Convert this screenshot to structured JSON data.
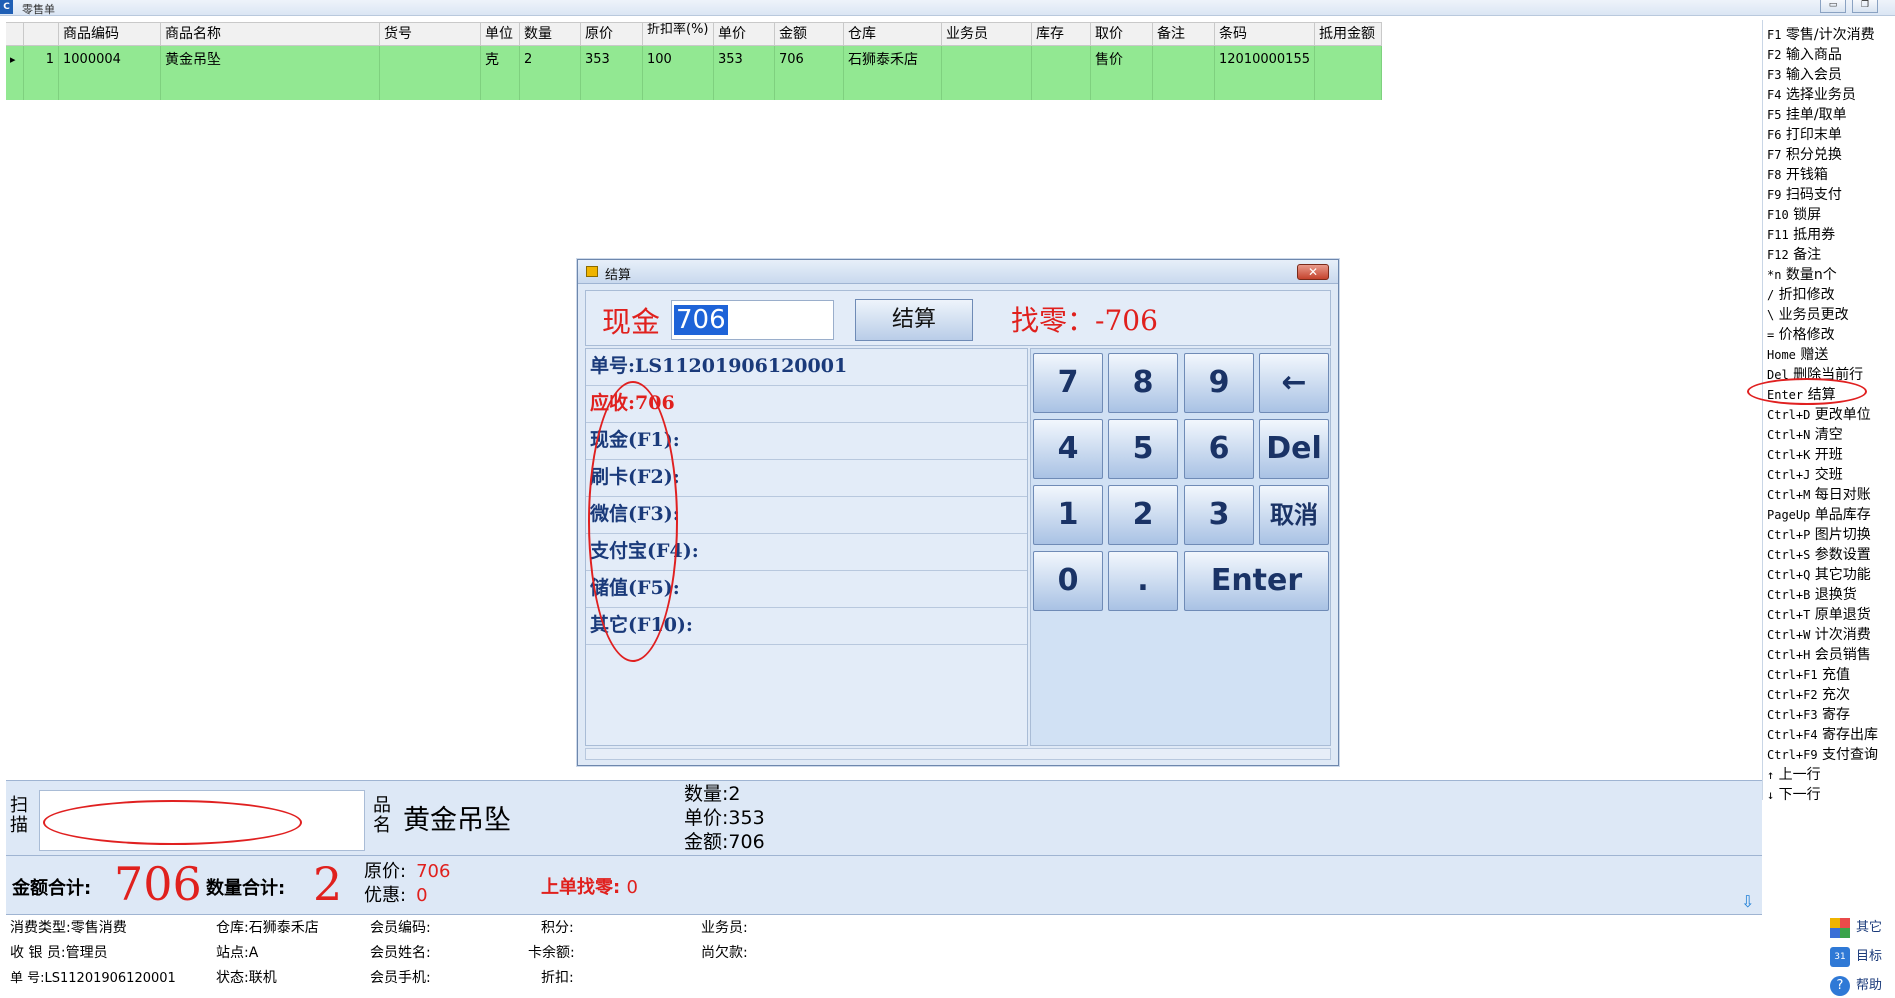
{
  "window": {
    "title": "零售单",
    "app_icon": "C",
    "min_label": "▭",
    "restore_label": "❐"
  },
  "grid": {
    "headers": [
      "",
      "",
      "商品编码",
      "商品名称",
      "货号",
      "单位",
      "数量",
      "原价",
      "折扣率(%)",
      "单价",
      "金额",
      "仓库",
      "业务员",
      "库存",
      "取价",
      "备注",
      "条码",
      "抵用金额"
    ],
    "row": {
      "indicator": "▸",
      "index": "1",
      "code": "1000004",
      "name": "黄金吊坠",
      "item_no": "",
      "unit": "克",
      "qty": "2",
      "orig_price": "353",
      "discount": "100",
      "price": "353",
      "amount": "706",
      "warehouse": "石狮泰禾店",
      "salesman": "",
      "stock": "",
      "price_type": "售价",
      "remark": "",
      "barcode": "12010000155",
      "offset": ""
    }
  },
  "shortcuts": [
    {
      "k": "F1",
      "t": " 零售/计次消费"
    },
    {
      "k": "F2",
      "t": " 输入商品"
    },
    {
      "k": "F3",
      "t": " 输入会员"
    },
    {
      "k": "F4",
      "t": " 选择业务员"
    },
    {
      "k": "F5",
      "t": " 挂单/取单"
    },
    {
      "k": "F6",
      "t": " 打印末单"
    },
    {
      "k": "F7",
      "t": " 积分兑换"
    },
    {
      "k": "F8",
      "t": " 开钱箱"
    },
    {
      "k": "F9",
      "t": " 扫码支付"
    },
    {
      "k": "F10",
      "t": " 锁屏"
    },
    {
      "k": "F11",
      "t": " 抵用券"
    },
    {
      "k": "F12",
      "t": " 备注"
    },
    {
      "k": "*n",
      "t": "  数量n个"
    },
    {
      "k": "/",
      "t": " 折扣修改"
    },
    {
      "k": "\\",
      "t": " 业务员更改"
    },
    {
      "k": "=",
      "t": " 价格修改"
    },
    {
      "k": "Home",
      "t": " 赠送"
    },
    {
      "k": "Del",
      "t": " 删除当前行"
    },
    {
      "k": "Enter",
      "t": " 结算"
    },
    {
      "k": "Ctrl+D",
      "t": " 更改单位"
    },
    {
      "k": "Ctrl+N",
      "t": " 清空"
    },
    {
      "k": "Ctrl+K",
      "t": " 开班"
    },
    {
      "k": "Ctrl+J",
      "t": " 交班"
    },
    {
      "k": "Ctrl+M",
      "t": " 每日对账"
    },
    {
      "k": "PageUp",
      "t": " 单品库存"
    },
    {
      "k": "Ctrl+P",
      "t": " 图片切换"
    },
    {
      "k": "Ctrl+S",
      "t": " 参数设置"
    },
    {
      "k": "Ctrl+Q",
      "t": " 其它功能"
    },
    {
      "k": "Ctrl+B",
      "t": " 退换货"
    },
    {
      "k": "Ctrl+T",
      "t": " 原单退货"
    },
    {
      "k": "Ctrl+W",
      "t": " 计次消费"
    },
    {
      "k": "Ctrl+H",
      "t": " 会员销售"
    },
    {
      "k": "Ctrl+F1",
      "t": " 充值"
    },
    {
      "k": "Ctrl+F2",
      "t": " 充次"
    },
    {
      "k": "Ctrl+F3",
      "t": " 寄存"
    },
    {
      "k": "Ctrl+F4",
      "t": " 寄存出库"
    },
    {
      "k": "Ctrl+F9",
      "t": " 支付查询"
    },
    {
      "k": "↑",
      "t": "  上一行"
    },
    {
      "k": "↓",
      "t": "  下一行"
    }
  ],
  "dialog": {
    "title": "结算",
    "close_label": "✕",
    "cash_label": "现金",
    "cash_value": "706",
    "settle_label": "结算",
    "change_text": "找零：-706",
    "rows": [
      "单号:LS11201906120001",
      "应收:706",
      "现金(F1):",
      "刷卡(F2):",
      "微信(F3):",
      "支付宝(F4):",
      "储值(F5):",
      "其它(F10):"
    ],
    "keys": [
      "7",
      "8",
      "9",
      "←",
      "4",
      "5",
      "6",
      "Del",
      "1",
      "2",
      "3",
      "取消",
      "0",
      ".",
      "Enter"
    ]
  },
  "scan": {
    "scan_label": "扫描",
    "pname_label": "品名",
    "product_name": "黄金吊坠",
    "qty_line": "数量:2",
    "price_line": "单价:353",
    "amount_line": "金额:706"
  },
  "totals": {
    "amount_label": "金额合计:",
    "amount_value": "706",
    "qty_label": "数量合计:",
    "qty_value": "2",
    "orig_label": "原价:",
    "orig_value": "706",
    "discount_label": "优惠:",
    "discount_value": "0",
    "last_change_label": "上单找零:",
    "last_change_value": "0",
    "down_icon": "⇩"
  },
  "info": {
    "consume_type": "消费类型:零售消费",
    "cashier": "收 银 员:管理员",
    "order_no": "单    号:LS11201906120001",
    "warehouse": "仓库:石狮泰禾店",
    "site": "站点:A",
    "status": "状态:联机",
    "member_code": "会员编码:",
    "member_name": "会员姓名:",
    "member_phone": "会员手机:",
    "points": "积分:",
    "card_balance": "卡余额:",
    "discount": "折扣:",
    "salesman": "业务员:",
    "owed": "尚欠款:"
  },
  "tools": {
    "other": "其它",
    "target": "目标",
    "help": "帮助"
  }
}
